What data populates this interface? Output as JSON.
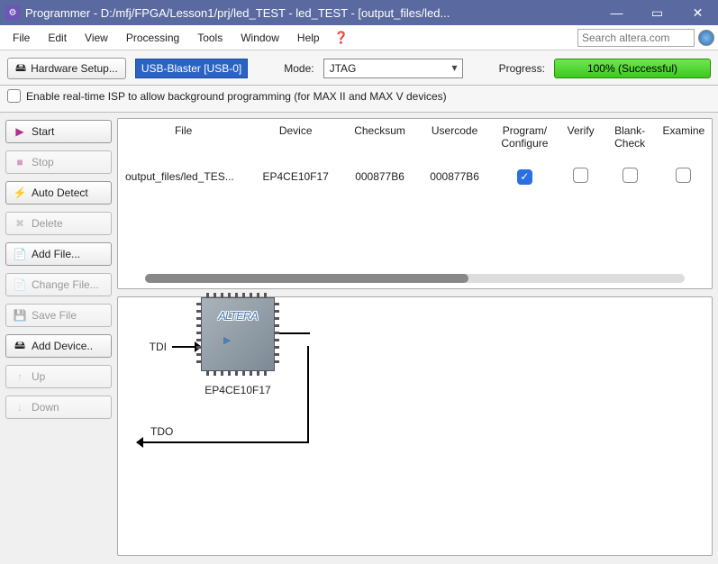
{
  "title": "Programmer - D:/mfj/FPGA/Lesson1/prj/led_TEST - led_TEST - [output_files/led...",
  "menu": [
    "File",
    "Edit",
    "View",
    "Processing",
    "Tools",
    "Window",
    "Help"
  ],
  "search_placeholder": "Search altera.com",
  "toolbar": {
    "hardware_setup_label": "Hardware Setup...",
    "selected_hardware": "USB-Blaster [USB-0]",
    "mode_label": "Mode:",
    "mode_value": "JTAG",
    "progress_label": "Progress:",
    "progress_text": "100% (Successful)"
  },
  "isp_checkbox_label": "Enable real-time ISP to allow background programming (for MAX II and MAX V devices)",
  "sidebar": [
    {
      "label": "Start",
      "icon": "▶",
      "enabled": true,
      "key": "start"
    },
    {
      "label": "Stop",
      "icon": "■",
      "enabled": false,
      "key": "stop"
    },
    {
      "label": "Auto Detect",
      "icon": "🔍",
      "enabled": true,
      "key": "auto-detect"
    },
    {
      "label": "Delete",
      "icon": "✖",
      "enabled": false,
      "key": "delete"
    },
    {
      "label": "Add File...",
      "icon": "📄",
      "enabled": true,
      "key": "add-file"
    },
    {
      "label": "Change File...",
      "icon": "📄",
      "enabled": false,
      "key": "change-file"
    },
    {
      "label": "Save File",
      "icon": "💾",
      "enabled": false,
      "key": "save-file"
    },
    {
      "label": "Add Device..",
      "icon": "🖴",
      "enabled": true,
      "key": "add-device"
    },
    {
      "label": "Up",
      "icon": "↑",
      "enabled": false,
      "key": "up"
    },
    {
      "label": "Down",
      "icon": "↓",
      "enabled": false,
      "key": "down"
    }
  ],
  "table": {
    "headers": [
      "File",
      "Device",
      "Checksum",
      "Usercode",
      "Program/\nConfigure",
      "Verify",
      "Blank-\nCheck",
      "Examine"
    ],
    "row": {
      "file": "output_files/led_TES...",
      "device": "EP4CE10F17",
      "checksum": "000877B6",
      "usercode": "000877B6",
      "program": true,
      "verify": false,
      "blank": false,
      "examine": false
    }
  },
  "chain": {
    "tdi": "TDI",
    "tdo": "TDO",
    "chip_brand": "ALTERA",
    "device": "EP4CE10F17"
  }
}
